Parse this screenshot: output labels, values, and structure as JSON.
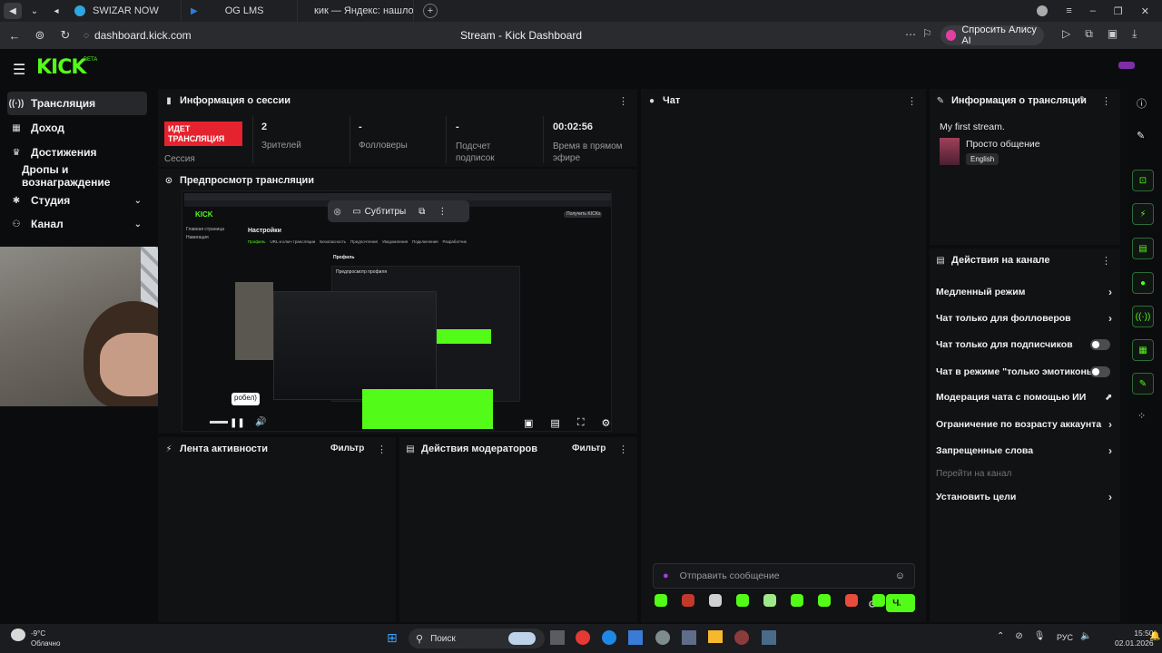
{
  "browser": {
    "tabs": [
      {
        "label": "SWIZAR NOW",
        "icon": "telegram-icon",
        "color": "#2ea6e0"
      },
      {
        "label": "OG LMS",
        "icon": "play-icon",
        "color": "#2f7de1"
      },
      {
        "label": "кик — Яндекс: нашлось 7",
        "icon": "yandex-icon",
        "color": "#e53935"
      }
    ],
    "url": "dashboard.kick.com",
    "page_title": "Stream - Kick Dashboard",
    "alice_label": "Спросить Алису AI"
  },
  "brand": {
    "logo": "KICK",
    "beta": "BETA",
    "accent": "#53fc18"
  },
  "sidebar": {
    "items": [
      {
        "label": "Трансляция",
        "icon": "stream-icon"
      },
      {
        "label": "Доход",
        "icon": "income-icon"
      },
      {
        "label": "Достижения",
        "icon": "achievements-icon"
      },
      {
        "label": "Дропы и вознаграждение",
        "icon": ""
      },
      {
        "label": "Студия",
        "icon": "studio-icon"
      },
      {
        "label": "Канал",
        "icon": "channel-icon"
      }
    ]
  },
  "session": {
    "title": "Информация о сессии",
    "live_badge": "ИДЕТ ТРАНСЛЯЦИЯ",
    "session_label": "Сессия",
    "stats": [
      {
        "value": "2",
        "label": "Зрителей"
      },
      {
        "value": "-",
        "label": "Фолловеры"
      },
      {
        "value": "-",
        "label": "Подсчет подписок"
      },
      {
        "value": "00:02:56",
        "label": "Время в прямом эфире"
      }
    ]
  },
  "preview": {
    "title": "Предпросмотр трансляции",
    "subtitles_label": "Субтитры",
    "tooltip_fragment": "робел)",
    "inner": {
      "logo": "KICK",
      "heading": "Настройки",
      "tabs": [
        "Профиль",
        "URL и ключ трансляции",
        "Безопасность",
        "Предпочтения",
        "Уведомления",
        "Подключения",
        "Разработчик"
      ],
      "nav": [
        "Главная страница",
        "Навигация"
      ],
      "section": "Профиль",
      "subsection": "Предпросмотр профиля",
      "banner_button": "Получить KICKs"
    }
  },
  "activity": {
    "title": "Лента активности",
    "filter_label": "Фильтр"
  },
  "moderators": {
    "title": "Действия модераторов",
    "filter_label": "Фильтр"
  },
  "chat": {
    "title": "Чат",
    "placeholder": "Отправить сообщение",
    "send_label": "Чат"
  },
  "stream_info": {
    "title": "Информация о трансляции",
    "stream_title": "My first stream.",
    "category": "Просто общение",
    "language": "English"
  },
  "channel_actions": {
    "title": "Действия на канале",
    "items": [
      {
        "label": "Медленный режим",
        "control": "arrow"
      },
      {
        "label": "Чат только для фолловеров",
        "control": "arrow"
      },
      {
        "label": "Чат только для подписчиков",
        "control": "toggle"
      },
      {
        "label": "Чат в режиме \"только эмотиконы\"",
        "control": "toggle"
      },
      {
        "label": "Модерация чата с помощью ИИ",
        "control": "external"
      },
      {
        "label": "Ограничение по возрасту аккаунта",
        "control": "arrow"
      },
      {
        "label": "Запрещенные слова",
        "control": "arrow"
      }
    ],
    "goto_channel": "Перейти на канал",
    "set_goals": "Установить цели"
  },
  "taskbar": {
    "weather_temp": "-9°C",
    "weather_desc": "Облачно",
    "search_label": "Поиск",
    "lang": "РУС",
    "time": "15:50",
    "date": "02.01.2026"
  }
}
